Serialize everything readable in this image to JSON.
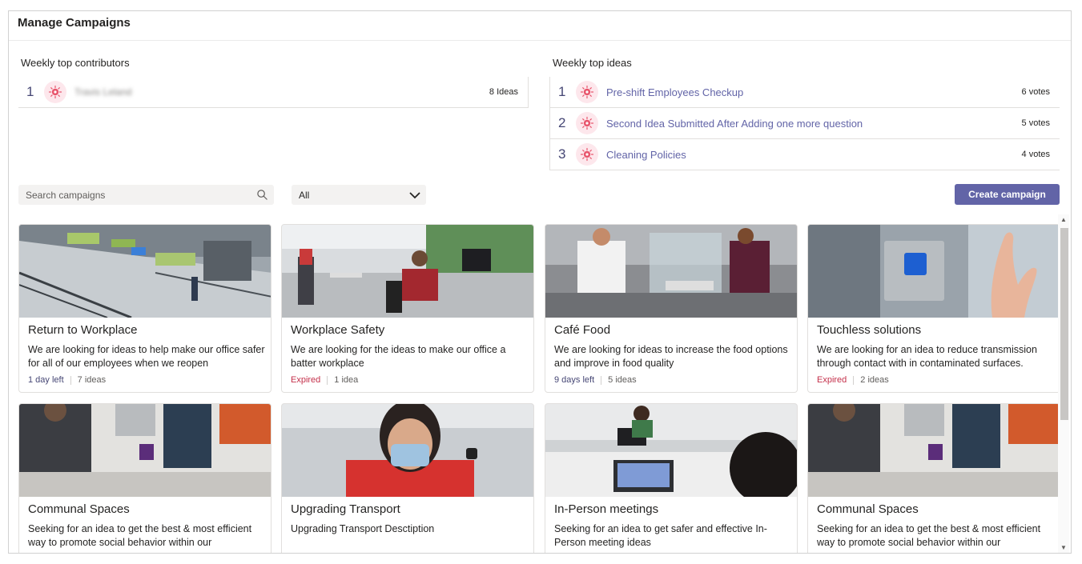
{
  "page": {
    "title": "Manage Campaigns"
  },
  "contributors": {
    "heading": "Weekly top contributors",
    "items": [
      {
        "rank": "1",
        "name": "Travis Leland",
        "count": "8 Ideas"
      }
    ]
  },
  "ideas": {
    "heading": "Weekly top ideas",
    "items": [
      {
        "rank": "1",
        "title": "Pre-shift Employees Checkup",
        "votes": "6 votes"
      },
      {
        "rank": "2",
        "title": "Second Idea Submitted After Adding one more question",
        "votes": "5 votes"
      },
      {
        "rank": "3",
        "title": "Cleaning Policies",
        "votes": "4 votes"
      }
    ]
  },
  "toolbar": {
    "search_placeholder": "Search campaigns",
    "filter_value": "All",
    "create_label": "Create campaign"
  },
  "campaigns": [
    {
      "title": "Return to Workplace",
      "description": "We are looking for ideas to help make our office safer for all of our employees when we reopen",
      "status": "1 day left",
      "ideas": "7 ideas"
    },
    {
      "title": "Workplace Safety",
      "description": "We are looking for the ideas to make our office a batter workplace",
      "status": "Expired",
      "ideas": "1 idea"
    },
    {
      "title": "Café Food",
      "description": "We are looking for ideas to increase the food options and improve in food quality",
      "status": "9 days left",
      "ideas": "5 ideas"
    },
    {
      "title": "Touchless solutions",
      "description": "We are looking for an idea to reduce transmission through contact with in contaminated surfaces.",
      "status": "Expired",
      "ideas": "2 ideas"
    },
    {
      "title": "Communal Spaces",
      "description": "Seeking for an idea to get the best & most efficient way to promote social behavior within our",
      "status": "",
      "ideas": ""
    },
    {
      "title": "Upgrading Transport",
      "description": "Upgrading Transport  Desctiption",
      "status": "",
      "ideas": ""
    },
    {
      "title": "In-Person meetings",
      "description": "Seeking for an idea to get safer and effective In-Person meeting ideas",
      "status": "",
      "ideas": ""
    },
    {
      "title": "Communal Spaces",
      "description": "Seeking for an idea to get the best & most efficient way to promote social behavior within our",
      "status": "",
      "ideas": ""
    }
  ],
  "colors": {
    "accent": "#6264a7",
    "expired": "#c4314b",
    "active": "#464775"
  },
  "icons": {
    "avatar": "lightbulb-icon",
    "search": "search-icon",
    "dropdown": "chevron-down-icon"
  }
}
